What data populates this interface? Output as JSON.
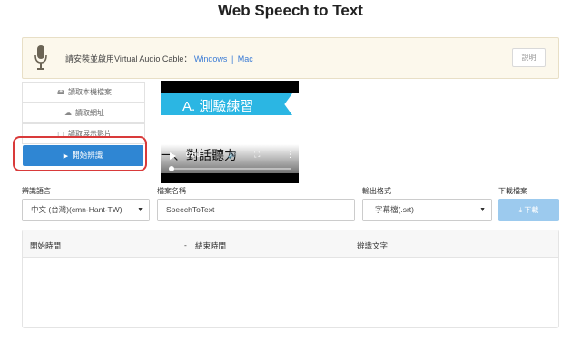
{
  "page": {
    "title": "Web Speech to Text"
  },
  "notice": {
    "text": "請安裝並啟用Virtual Audio Cable：",
    "link_windows": "Windows",
    "separator": "|",
    "link_mac": "Mac",
    "explain_label": "說明",
    "link_color": "#3a7bd5",
    "icon": "microphone-icon"
  },
  "source": {
    "items": [
      {
        "icon": "monitor-icon",
        "label": "讀取本機檔案"
      },
      {
        "icon": "cloud-icon",
        "label": "讀取網址"
      },
      {
        "icon": "screen-icon",
        "label": "讀取展示影片"
      }
    ],
    "start_label": "開始辨識",
    "start_color": "#2f86d3"
  },
  "video": {
    "ribbon_text": "A. 測驗練習",
    "subtitle_text": "一、對話聽力",
    "time": "0:00",
    "ribbon_color": "#2bb6e3",
    "progress": 0
  },
  "form": {
    "language_label": "辨識語言",
    "language_value": "中文 (台灣)(cmn-Hant-TW)",
    "filename_label": "檔案名稱",
    "filename_value": "SpeechToText",
    "format_label": "輸出格式",
    "format_value": "字幕檔(.srt)",
    "download_label": "下載檔案",
    "download_button": "下載",
    "download_color": "#9ccaee"
  },
  "table": {
    "columns": [
      "開始時間",
      "-",
      "結束時間",
      "辨識文字"
    ],
    "rows": []
  }
}
